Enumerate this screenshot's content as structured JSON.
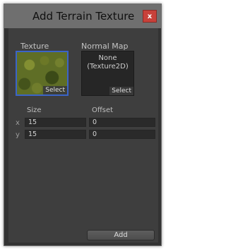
{
  "window": {
    "title": "Add Terrain Texture",
    "close_label": "x"
  },
  "texture": {
    "label": "Texture",
    "select_label": "Select"
  },
  "normal_map": {
    "label": "Normal Map",
    "empty_line1": "None",
    "empty_line2": "(Texture2D)",
    "select_label": "Select"
  },
  "tiling": {
    "size_label": "Size",
    "offset_label": "Offset",
    "rows": [
      {
        "axis": "x",
        "size": "15",
        "offset": "0"
      },
      {
        "axis": "y",
        "size": "15",
        "offset": "0"
      }
    ]
  },
  "add_button_label": "Add",
  "colors": {
    "titlebar": "#6f6f6f",
    "close": "#c8413a",
    "panel": "#3e3e3e",
    "selected_border": "#3b64c8"
  }
}
